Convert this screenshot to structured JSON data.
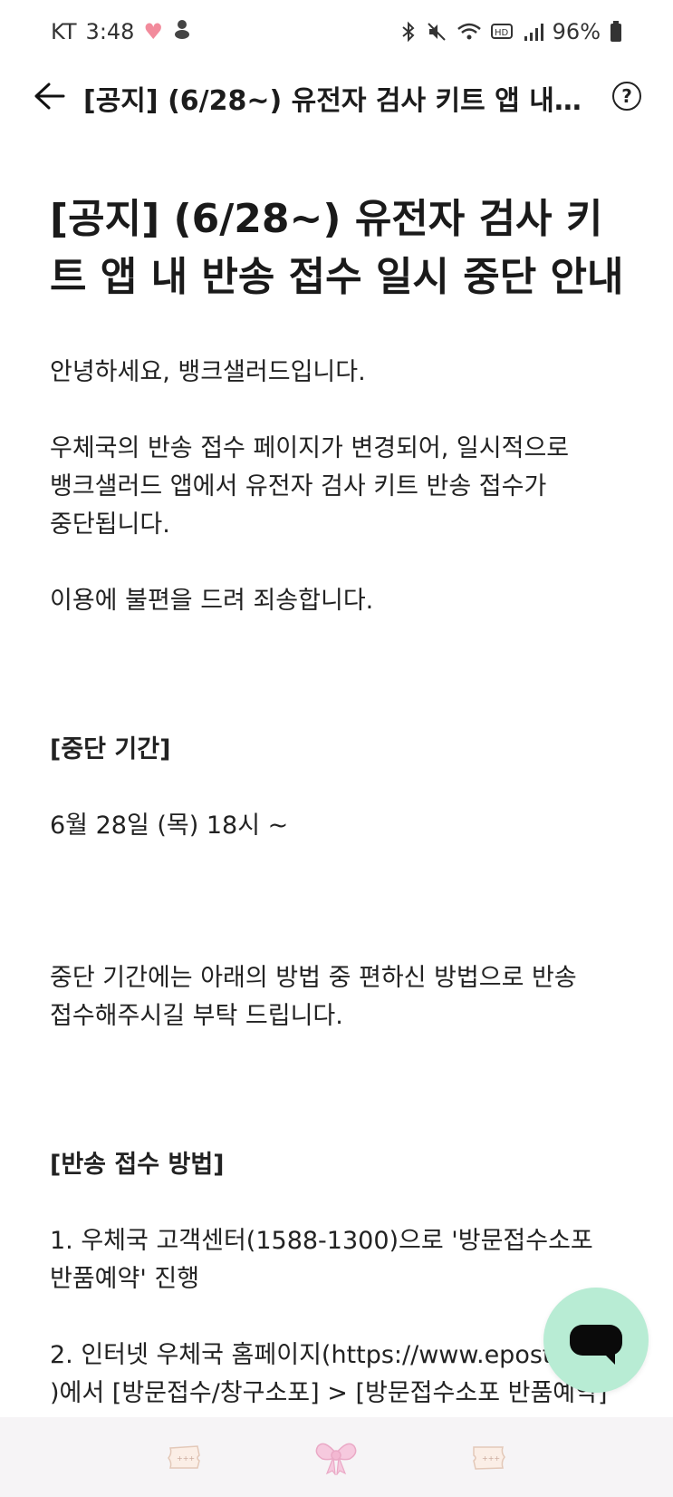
{
  "status_bar": {
    "carrier": "KT",
    "time": "3:48",
    "battery": "96%"
  },
  "app_bar": {
    "title": "[공지] (6/28~) 유전자 검사 키트 앱 내 반송 접수 일시 중단 안내",
    "help_label": "?"
  },
  "article": {
    "title": "[공지] (6/28~) 유전자 검사 키트 앱 내 반송 접수 일시 중단 안내",
    "greeting": "안녕하세요, 뱅크샐러드입니다.",
    "notice": "우체국의 반송 접수 페이지가 변경되어, 일시적으로\n뱅크샐러드 앱에서 유전자 검사 키트 반송 접수가\n중단됩니다.",
    "apology": "이용에 불편을 드려 죄송합니다.",
    "period_heading": "[중단 기간]",
    "period_value": "6월 28일 (목) 18시 ~",
    "period_guide": "중단 기간에는 아래의 방법 중 편하신 방법으로 반송\n접수해주시길 부탁 드립니다.",
    "method_heading": "[반송 접수 방법]",
    "method_1": "1. 우체국 고객센터(1588-1300)으로 '방문접수소포\n반품예약' 진행",
    "method_2": "2. 인터넷 우체국 홈페이지(https://www.epost.go.kr\n)에서 [방문접수/창구소포] > [방문접수소포 반품예약]"
  },
  "colors": {
    "chat_button": "#b8ecd4",
    "bottom_bar": "#f6f4f6",
    "heart": "#f28b9c"
  },
  "icons": {
    "back": "back-arrow-icon",
    "help": "help-circle-icon",
    "chat": "chat-bubble-icon"
  }
}
